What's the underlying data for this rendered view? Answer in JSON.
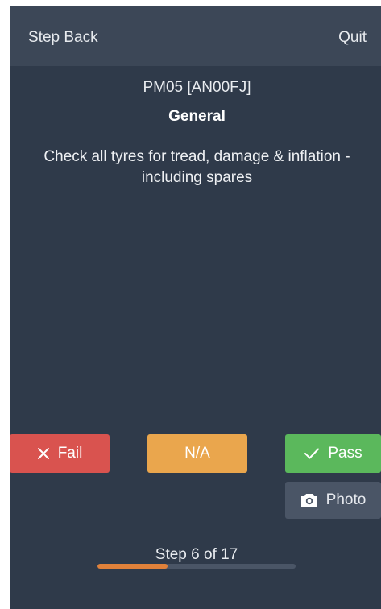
{
  "header": {
    "back_label": "Step Back",
    "quit_label": "Quit"
  },
  "inspection": {
    "code": "PM05 [AN00FJ]",
    "section": "General",
    "instruction": "Check all tyres for tread, damage & inflation - including spares"
  },
  "actions": {
    "fail_label": "Fail",
    "na_label": "N/A",
    "pass_label": "Pass",
    "photo_label": "Photo"
  },
  "icons": {
    "fail": "close-icon",
    "pass": "check-icon",
    "photo": "camera-icon"
  },
  "colors": {
    "background": "#2f3a4a",
    "header": "#3c4757",
    "fail": "#d9534f",
    "na": "#eaa64d",
    "pass": "#5bb85c",
    "photo": "#4a5566",
    "progress": "#e0813a"
  },
  "progress": {
    "label": "Step 6 of 17",
    "current": 6,
    "total": 17
  }
}
